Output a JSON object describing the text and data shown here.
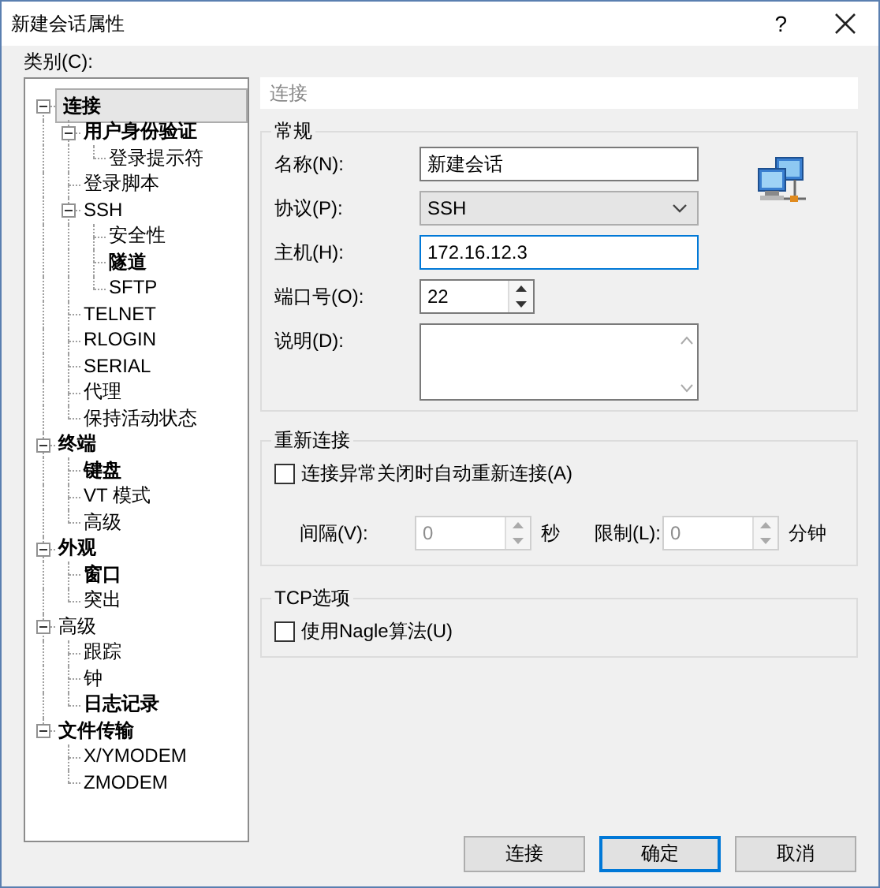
{
  "window": {
    "title": "新建会话属性",
    "help": "?"
  },
  "category_label": "类别(C):",
  "tree": [
    {
      "label": "连接",
      "bold": true,
      "selected": true,
      "expanded": true,
      "children": [
        {
          "label": "用户身份验证",
          "bold": true,
          "selected": false,
          "expanded": true,
          "children": [
            {
              "label": "登录提示符",
              "bold": false,
              "selected": false
            }
          ]
        },
        {
          "label": "登录脚本",
          "bold": false,
          "selected": false
        },
        {
          "label": "SSH",
          "bold": false,
          "selected": false,
          "expanded": true,
          "children": [
            {
              "label": "安全性",
              "bold": false,
              "selected": false
            },
            {
              "label": "隧道",
              "bold": true,
              "selected": false
            },
            {
              "label": "SFTP",
              "bold": false,
              "selected": false
            }
          ]
        },
        {
          "label": "TELNET",
          "bold": false,
          "selected": false
        },
        {
          "label": "RLOGIN",
          "bold": false,
          "selected": false
        },
        {
          "label": "SERIAL",
          "bold": false,
          "selected": false
        },
        {
          "label": "代理",
          "bold": false,
          "selected": false
        },
        {
          "label": "保持活动状态",
          "bold": false,
          "selected": false
        }
      ]
    },
    {
      "label": "终端",
      "bold": true,
      "selected": false,
      "expanded": true,
      "children": [
        {
          "label": "键盘",
          "bold": true,
          "selected": false
        },
        {
          "label": "VT 模式",
          "bold": false,
          "selected": false
        },
        {
          "label": "高级",
          "bold": false,
          "selected": false
        }
      ]
    },
    {
      "label": "外观",
      "bold": true,
      "selected": false,
      "expanded": true,
      "children": [
        {
          "label": "窗口",
          "bold": true,
          "selected": false
        },
        {
          "label": "突出",
          "bold": false,
          "selected": false
        }
      ]
    },
    {
      "label": "高级",
      "bold": false,
      "selected": false,
      "expanded": true,
      "children": [
        {
          "label": "跟踪",
          "bold": false,
          "selected": false
        },
        {
          "label": "钟",
          "bold": false,
          "selected": false
        },
        {
          "label": "日志记录",
          "bold": true,
          "selected": false
        }
      ]
    },
    {
      "label": "文件传输",
      "bold": true,
      "selected": false,
      "expanded": true,
      "children": [
        {
          "label": "X/YMODEM",
          "bold": false,
          "selected": false
        },
        {
          "label": "ZMODEM",
          "bold": false,
          "selected": false
        }
      ]
    }
  ],
  "panel_header": "连接",
  "general": {
    "title": "常规",
    "fields": [
      {
        "kind": "text",
        "label": "名称(N):",
        "value": "新建会话",
        "focused": false
      },
      {
        "kind": "select",
        "label": "协议(P):",
        "value": "SSH"
      },
      {
        "kind": "text",
        "label": "主机(H):",
        "value": "172.16.12.3",
        "focused": true
      },
      {
        "kind": "spin",
        "label": "端口号(O):",
        "value": "22"
      },
      {
        "kind": "textarea",
        "label": "说明(D):"
      }
    ]
  },
  "reconnect": {
    "title": "重新连接",
    "checkbox": {
      "label": "连接异常关闭时自动重新连接(A)",
      "checked": false
    },
    "spinners": [
      {
        "label": "间隔(V):",
        "value": "0",
        "unit": "秒",
        "disabled": true
      },
      {
        "label": "限制(L):",
        "value": "0",
        "unit": "分钟",
        "disabled": true
      }
    ]
  },
  "tcp": {
    "title": "TCP选项",
    "checkbox": {
      "label": "使用Nagle算法(U)",
      "checked": false
    }
  },
  "buttons": [
    {
      "label": "连接",
      "focused": false
    },
    {
      "label": "确定",
      "focused": true
    },
    {
      "label": "取消",
      "focused": false
    }
  ]
}
